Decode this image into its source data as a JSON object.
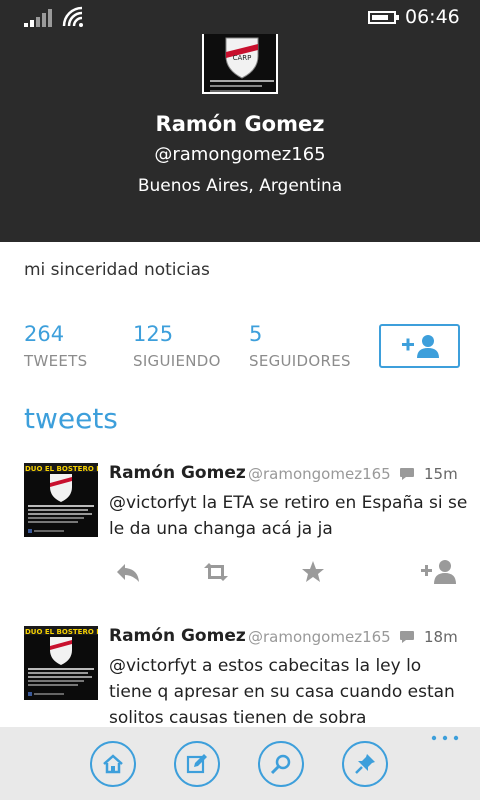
{
  "status_bar": {
    "time": "06:46",
    "battery_level": 0.8,
    "signal_icon": "signal-bars-icon",
    "wifi_icon": "wifi-icon"
  },
  "profile": {
    "name": "Ramón Gomez",
    "handle": "@ramongomez165",
    "location": "Buenos Aires, Argentina",
    "bio": "mi sinceridad noticias",
    "avatar_caption": "DUO EL BOSTERO FANTINI"
  },
  "stats": [
    {
      "value": "264",
      "label": "TWEETS"
    },
    {
      "value": "125",
      "label": "SIGUIENDO"
    },
    {
      "value": "5",
      "label": "SEGUIDORES"
    }
  ],
  "follow_icon": "add-person-icon",
  "section_title": "tweets",
  "tweets": [
    {
      "name": "Ramón Gomez",
      "handle": "@ramongomez165",
      "time": "15m",
      "text": "@victorfyt la ETA se retiro en España si se le da una changa acá ja ja"
    },
    {
      "name": "Ramón Gomez",
      "handle": "@ramongomez165",
      "time": "18m",
      "text": "@victorfyt a estos cabecitas la ley lo tiene q apresar en su casa cuando estan solitos causas tienen de sobra"
    }
  ],
  "app_bar": {
    "buttons": [
      "home-icon",
      "compose-icon",
      "search-icon",
      "pin-icon"
    ],
    "more_icon": "more-dots-icon"
  },
  "colors": {
    "accent": "#3d9fdb",
    "header_bg": "#2b2b2b",
    "appbar_bg": "#e9e9e9"
  }
}
